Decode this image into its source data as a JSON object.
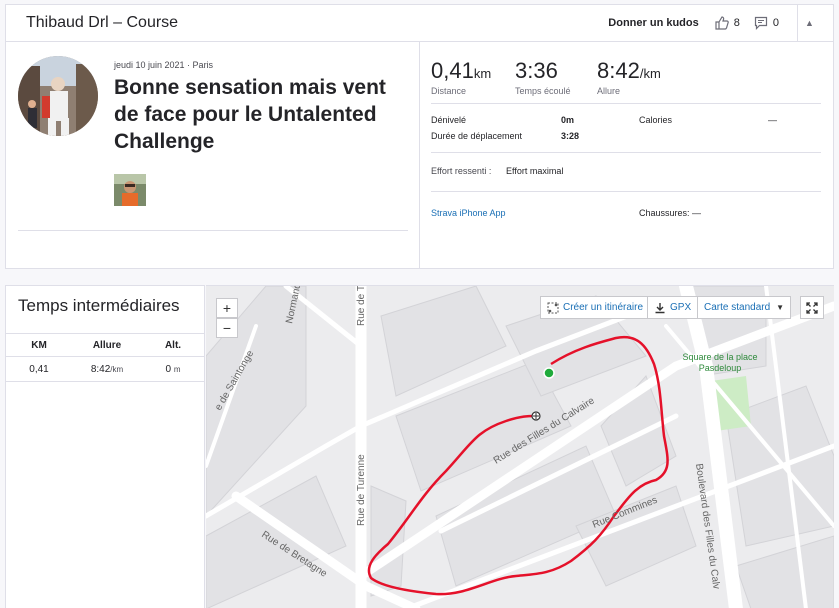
{
  "header": {
    "title": "Thibaud Drl – Course",
    "kudos_button": "Donner un kudos",
    "kudos_count": "8",
    "comment_count": "0"
  },
  "activity": {
    "meta": "jeudi 10 juin 2021 · Paris",
    "title": "Bonne sensation mais vent de face pour le Untalented Challenge"
  },
  "stats": {
    "distance": {
      "value": "0,41",
      "unit": "km",
      "label": "Distance"
    },
    "elapsed": {
      "value": "3:36",
      "label": "Temps écoulé"
    },
    "pace": {
      "value": "8:42",
      "unit": "/km",
      "label": "Allure"
    },
    "elevation": {
      "label": "Dénivelé",
      "value": "0m"
    },
    "moving_time": {
      "label": "Durée de déplacement",
      "value": "3:28"
    },
    "calories": {
      "label": "Calories",
      "value": "—"
    },
    "effort": {
      "label": "Effort ressenti :",
      "value": "Effort maximal"
    },
    "device": "Strava iPhone App",
    "shoes": "Chaussures: —"
  },
  "splits": {
    "title": "Temps intermédiaires",
    "columns": [
      "KM",
      "Allure",
      "Alt."
    ],
    "rows": [
      {
        "km": "0,41",
        "pace": "8:42",
        "pace_unit": "/km",
        "alt": "0",
        "alt_unit": "m"
      }
    ]
  },
  "map": {
    "zoom_in": "+",
    "zoom_out": "−",
    "create_route": "Créer un itinéraire",
    "gpx": "GPX",
    "map_type": "Carte standard",
    "streets": {
      "normandie": "Normandie",
      "saintonge": "e de Saintonge",
      "turenne": "Rue de Turenne",
      "t_top": "Rue de T",
      "bretagne": "Rue de Bretagne",
      "filles_calvaire": "Rue des Filles du Calvaire",
      "commines": "Rue Commines",
      "boulevard": "Boulevard des Filles du Calv",
      "square": "Square de la place Pasdeloup"
    }
  },
  "colors": {
    "route": "#e5112a",
    "start_marker": "#1faa3b",
    "link": "#1a6fb5",
    "park": "#cdecc5"
  }
}
